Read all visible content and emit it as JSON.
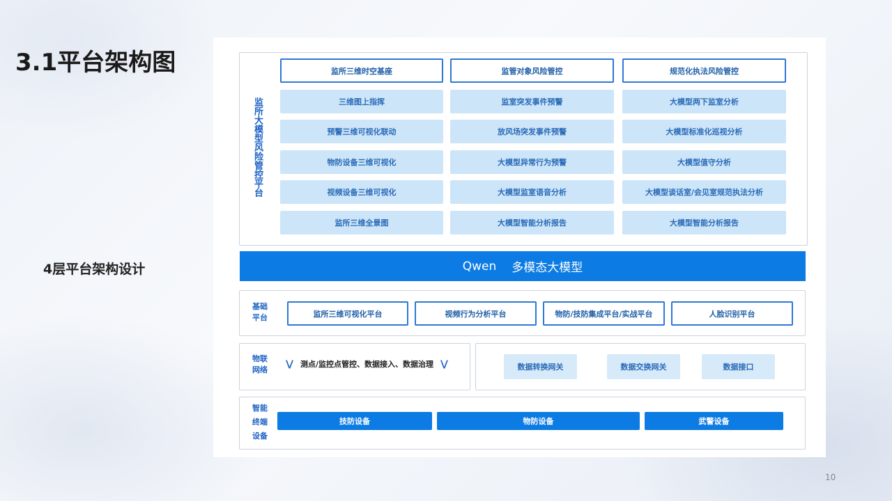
{
  "slide": {
    "title": "3.1平台架构图",
    "subtitle": "4层平台架构设计",
    "page_number": "10"
  },
  "risk_platform": {
    "label": "监所大模型风险管控平台",
    "headers": [
      "监所三维时空基座",
      "监管对象风险管控",
      "规范化执法风险管控"
    ],
    "columns": [
      [
        "三维图上指挥",
        "预警三维可视化联动",
        "物防设备三维可视化",
        "视频设备三维可视化",
        "监所三维全景图"
      ],
      [
        "监室突发事件预警",
        "放风场突发事件预警",
        "大模型异常行为预警",
        "大模型监室语音分析",
        "大模型智能分析报告"
      ],
      [
        "大模型两下监室分析",
        "大模型标准化巡视分析",
        "大模型值守分析",
        "大模型谈话室/会见室规范执法分析",
        "大模型智能分析报告"
      ]
    ]
  },
  "model": {
    "name": "Qwen",
    "label": "多模态大模型"
  },
  "base_platform": {
    "label_line1": "基础",
    "label_line2": "平台",
    "items": [
      "监所三维可视化平台",
      "视频行为分析平台",
      "物防/技防集成平台/实战平台",
      "人脸识别平台"
    ]
  },
  "iot": {
    "label_line1": "物联",
    "label_line2": "网络",
    "text": "测点/监控点管控、数据接入、数据治理",
    "gateways": [
      "数据转换网关",
      "数据交换网关",
      "数据接口"
    ]
  },
  "terminal": {
    "label_line1": "智能",
    "label_line2": "终端",
    "label_line3": "设备",
    "items": [
      "技防设备",
      "物防设备",
      "武警设备"
    ]
  },
  "icons": {
    "chevron": "chevron-down-double-icon"
  },
  "colors": {
    "accent": "#0c7be3",
    "outline": "#2c78d4",
    "fill": "#cde5f8",
    "label": "#1e63c4"
  }
}
